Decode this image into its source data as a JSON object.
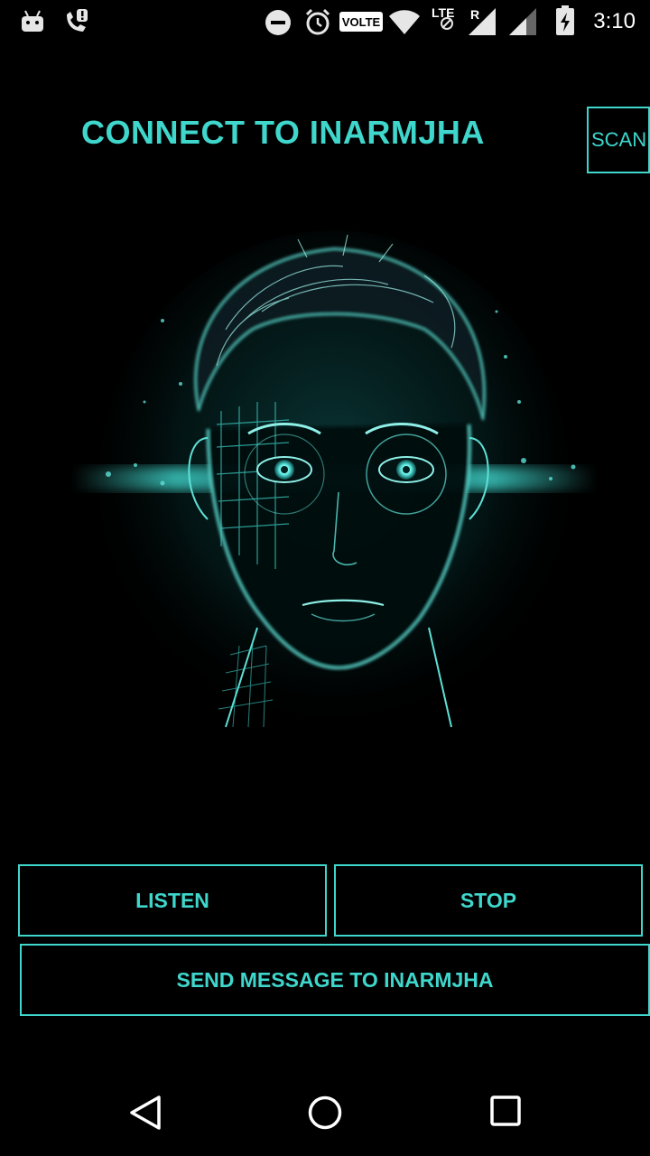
{
  "status_bar": {
    "time": "3:10",
    "volte_label": "VOLTE",
    "lte_label": "LTE",
    "roaming_label": "R",
    "icons": [
      "android-icon",
      "missed-call-icon",
      "do-not-disturb-icon",
      "alarm-icon",
      "volte-icon",
      "wifi-icon",
      "lte-icon",
      "signal-icon",
      "signal-icon-2",
      "battery-charging-icon"
    ]
  },
  "header": {
    "title": "CONNECT TO INARMJHA",
    "scan_label": "SCAN"
  },
  "image": {
    "description": "glowing-cyan-face-illustration"
  },
  "controls": {
    "listen_label": "LISTEN",
    "stop_label": "STOP",
    "send_label": "SEND MESSAGE TO INARMJHA"
  },
  "nav_bar": {
    "icons": [
      "back-icon",
      "home-icon",
      "recents-icon"
    ]
  },
  "colors": {
    "accent": "#3fd6cc",
    "background": "#000000"
  }
}
